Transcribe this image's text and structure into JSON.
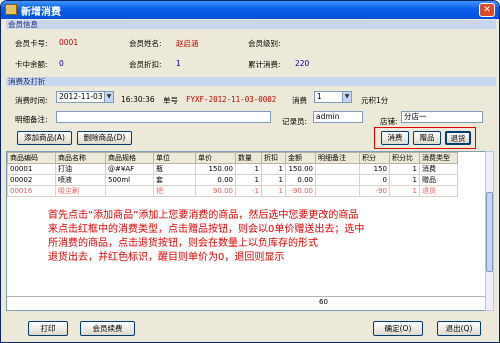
{
  "window": {
    "title": "新增消费",
    "close_label": "✕"
  },
  "member_section": {
    "header": "会员信息",
    "card_no_label": "会员卡号:",
    "card_no": "0001",
    "name_label": "会员姓名:",
    "name": "赵启涵",
    "level_label": "会员级别:",
    "level": "",
    "balance_label": "卡中余额:",
    "balance": "0",
    "discount_label": "会员折扣:",
    "discount": "1",
    "points_label": "累计消费:",
    "points": "220"
  },
  "consume_section": {
    "header": "消费及打折",
    "time_label": "消费时间:",
    "date": "2012-11-03",
    "time": "16:30:36",
    "order_label": "单号",
    "order_no": "FYXF-2012-11-03-0002",
    "qty_label": "消费",
    "qty_value": "1",
    "yuan_label": "元积1分",
    "note_label": "明细备注:",
    "note_value": "",
    "recorder_label": "记录员:",
    "recorder_value": "admin",
    "shop_label": "店铺:",
    "shop_value": "分店一"
  },
  "toolbar": {
    "add_goods": "添加商品(A)",
    "delete_goods": "删除商品(D)",
    "consume_btn": "消费",
    "gift_btn": "赠品",
    "return_btn": "退货"
  },
  "grid": {
    "columns": [
      "商品编码",
      "商品名称",
      "商品规格",
      "单位",
      "单价",
      "数量",
      "折扣",
      "金额",
      "明细备注",
      "积分",
      "积分比",
      "消费类型"
    ],
    "rows": [
      [
        "00001",
        "打油",
        "@#¥AF",
        "瓶",
        "150.00",
        "1",
        "1",
        "150.00",
        "",
        "150",
        "1",
        "消费"
      ],
      [
        "00002",
        "喷液",
        "500ml",
        "套",
        "0.00",
        "1",
        "1",
        "0.00",
        "",
        "0",
        "1",
        "赠品"
      ],
      [
        "00016",
        "吸尘刷",
        "",
        "把",
        "90.00",
        "-1",
        "1",
        "-90.00",
        "",
        "-90",
        "1",
        "退货"
      ]
    ],
    "total": "60"
  },
  "annotation": [
    "首先点击“添加商品”添加上您要消费的商品，然后选中您要更改的商品",
    "来点击红框中的消费类型，点击赠品按钮，则会以0单价赠送出去；选中",
    "所消费的商品，点击退货按钮，则会在数量上以负库存的形式",
    "退货出去，并红色标识，醒目则单价为0，退回则显示"
  ],
  "footer": {
    "print": "打印",
    "renew": "会员续费",
    "ok": "确定(O)",
    "exit": "退出(Q)"
  }
}
